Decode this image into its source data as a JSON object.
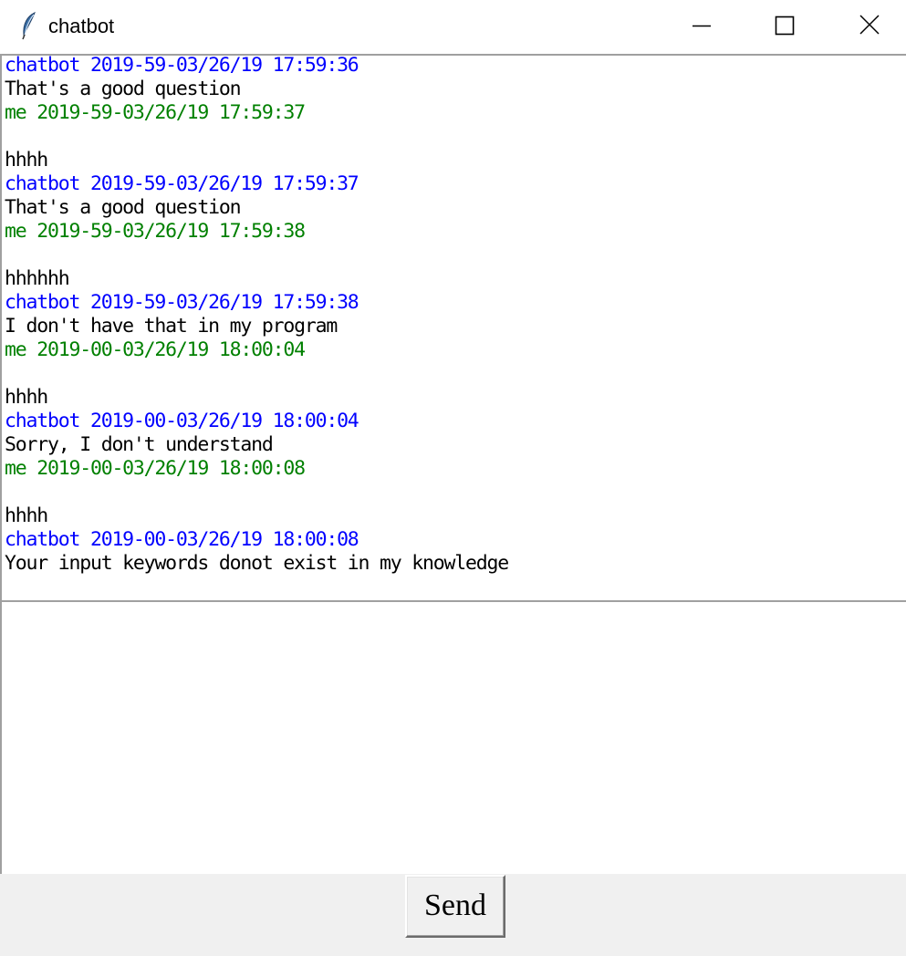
{
  "window": {
    "title": "chatbot",
    "icon": "feather-icon",
    "controls": [
      "minimize-icon",
      "maximize-icon",
      "close-icon"
    ]
  },
  "colors": {
    "bot_meta": "#0000ff",
    "me_meta": "#008000",
    "message_text": "#000000"
  },
  "chat_log": {
    "lines": [
      {
        "kind": "bot",
        "text": "chatbot 2019-59-03/26/19 17:59:36"
      },
      {
        "kind": "msg",
        "text": "That's a good question"
      },
      {
        "kind": "me",
        "text": "me 2019-59-03/26/19 17:59:37"
      },
      {
        "kind": "msg",
        "text": ""
      },
      {
        "kind": "msg",
        "text": "hhhh"
      },
      {
        "kind": "bot",
        "text": "chatbot 2019-59-03/26/19 17:59:37"
      },
      {
        "kind": "msg",
        "text": "That's a good question"
      },
      {
        "kind": "me",
        "text": "me 2019-59-03/26/19 17:59:38"
      },
      {
        "kind": "msg",
        "text": ""
      },
      {
        "kind": "msg",
        "text": "hhhhhh"
      },
      {
        "kind": "bot",
        "text": "chatbot 2019-59-03/26/19 17:59:38"
      },
      {
        "kind": "msg",
        "text": "I don't have that in my program"
      },
      {
        "kind": "me",
        "text": "me 2019-00-03/26/19 18:00:04"
      },
      {
        "kind": "msg",
        "text": ""
      },
      {
        "kind": "msg",
        "text": "hhhh"
      },
      {
        "kind": "bot",
        "text": "chatbot 2019-00-03/26/19 18:00:04"
      },
      {
        "kind": "msg",
        "text": "Sorry, I don't understand"
      },
      {
        "kind": "me",
        "text": "me 2019-00-03/26/19 18:00:08"
      },
      {
        "kind": "msg",
        "text": ""
      },
      {
        "kind": "msg",
        "text": "hhhh"
      },
      {
        "kind": "bot",
        "text": "chatbot 2019-00-03/26/19 18:00:08"
      },
      {
        "kind": "msg",
        "text": "Your input keywords donot exist in my knowledge"
      }
    ]
  },
  "input": {
    "value": ""
  },
  "send_button": {
    "label": "Send"
  }
}
